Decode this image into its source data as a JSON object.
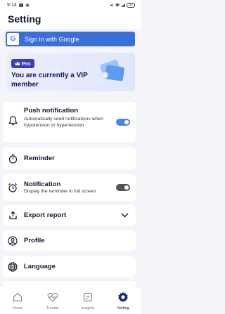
{
  "status": {
    "time": "9:14",
    "battery": "52"
  },
  "header": {
    "title": "Setting"
  },
  "google": {
    "label": "Sign in with Google",
    "logo": "G"
  },
  "vip": {
    "badge": "Pro",
    "text": "You are currently a VIP member"
  },
  "push": {
    "title": "Push notification",
    "subtitle": "Automatically send notifications when hypotension or hypertension",
    "enabled": true
  },
  "reminder": {
    "title": "Reminder"
  },
  "notification": {
    "title": "Notification",
    "subtitle": "Display the reminder in full screen",
    "enabled": false
  },
  "export": {
    "title": "Export report"
  },
  "profile": {
    "title": "Profile"
  },
  "language": {
    "title": "Language"
  },
  "nav": {
    "items": [
      {
        "label": "Home",
        "icon": "home-icon"
      },
      {
        "label": "Tracker",
        "icon": "heart-pulse-icon"
      },
      {
        "label": "Insights",
        "icon": "insights-icon"
      },
      {
        "label": "Setting",
        "icon": "gear-icon"
      }
    ],
    "active_index": 3
  },
  "colors": {
    "accent": "#3a6fd8",
    "pro_badge": "#3740b8",
    "toggle_on": "#4a86e8",
    "nav_active": "#1f2a6b"
  }
}
